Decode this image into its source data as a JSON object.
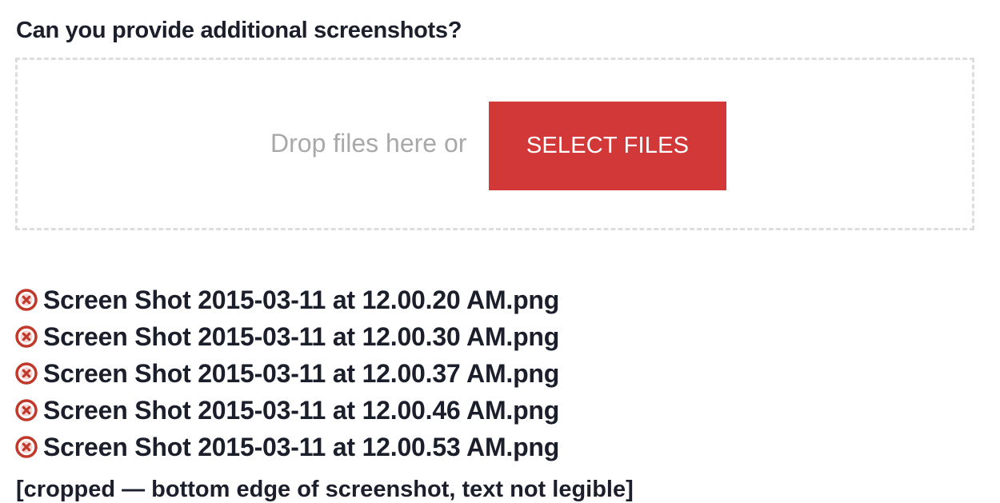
{
  "upload_section": {
    "heading": "Can you provide additional screenshots?",
    "dropzone": {
      "prompt": "Drop files here or",
      "select_button_label": "SELECT FILES"
    },
    "files": [
      {
        "name": "Screen Shot 2015-03-11 at 12.00.20 AM.png",
        "remove_icon": "remove-circle-x-icon"
      },
      {
        "name": "Screen Shot 2015-03-11 at 12.00.30 AM.png",
        "remove_icon": "remove-circle-x-icon"
      },
      {
        "name": "Screen Shot 2015-03-11 at 12.00.37 AM.png",
        "remove_icon": "remove-circle-x-icon"
      },
      {
        "name": "Screen Shot 2015-03-11 at 12.00.46 AM.png",
        "remove_icon": "remove-circle-x-icon"
      },
      {
        "name": "Screen Shot 2015-03-11 at 12.00.53 AM.png",
        "remove_icon": "remove-circle-x-icon"
      }
    ]
  },
  "next_section": {
    "heading_text": "[cropped — bottom edge of screenshot, text not legible]",
    "heading_cropped": true
  },
  "colors": {
    "accent": "#D33838",
    "heading_text": "#1B1F2B",
    "dropzone_text": "#A9A9A9",
    "dropzone_border": "#DDDDDD",
    "remove_icon": "#C0392B"
  }
}
